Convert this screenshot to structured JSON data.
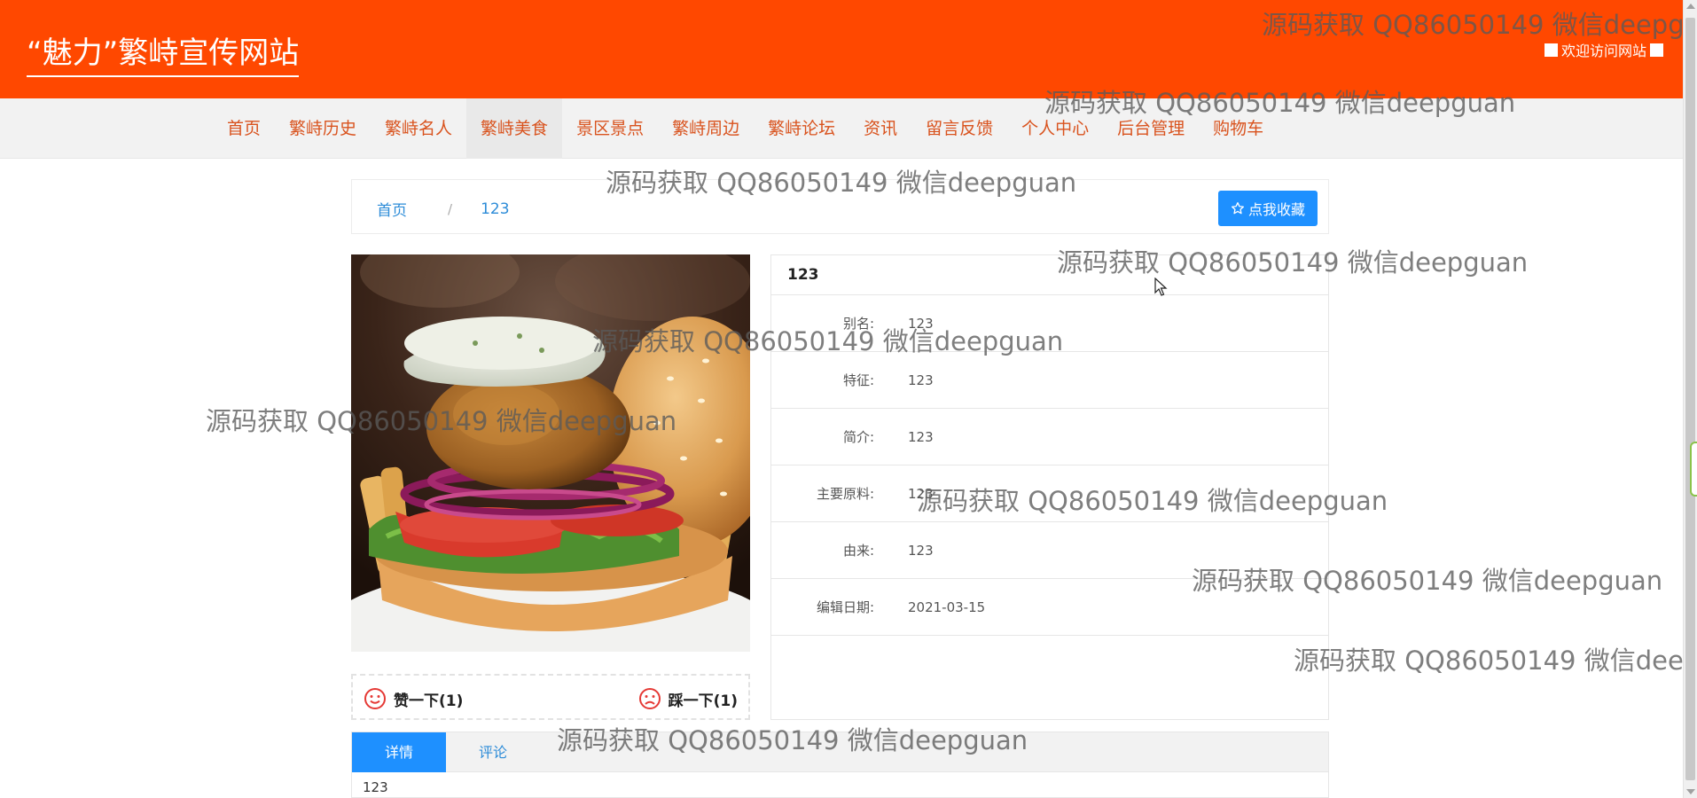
{
  "header": {
    "site_title": "“魅力”繁峙宣传网站",
    "welcome": "欢迎访问网站"
  },
  "nav": {
    "items": [
      "首页",
      "繁峙历史",
      "繁峙名人",
      "繁峙美食",
      "景区景点",
      "繁峙周边",
      "繁峙论坛",
      "资讯",
      "留言反馈",
      "个人中心",
      "后台管理",
      "购物车"
    ],
    "active": "繁峙美食"
  },
  "breadcrumb": {
    "home": "首页",
    "separator": "/",
    "current": "123"
  },
  "favorite_button": "点我收藏",
  "votes": {
    "up": "赞一下(1)",
    "down": "踩一下(1)"
  },
  "detail": {
    "title": "123",
    "rows": [
      {
        "label": "别名:",
        "value": "123"
      },
      {
        "label": "特征:",
        "value": "123"
      },
      {
        "label": "简介:",
        "value": "123"
      },
      {
        "label": "主要原料:",
        "value": "123"
      },
      {
        "label": "由来:",
        "value": "123"
      },
      {
        "label": "编辑日期:",
        "value": "2021-03-15"
      }
    ]
  },
  "tabs": {
    "items": [
      "详情",
      "评论"
    ],
    "active": "详情",
    "content": "123"
  },
  "watermark": "源码获取 QQ86050149 微信deepguan",
  "colors": {
    "header_bg": "#ff4800",
    "nav_text": "#d9531e",
    "primary_blue": "#1e90ff",
    "link_blue": "#2d8cd8",
    "vote_icon": "#e53935"
  },
  "icons": {
    "favorite": "star-icon",
    "vote_up": "smile-icon",
    "vote_down": "frown-icon"
  }
}
